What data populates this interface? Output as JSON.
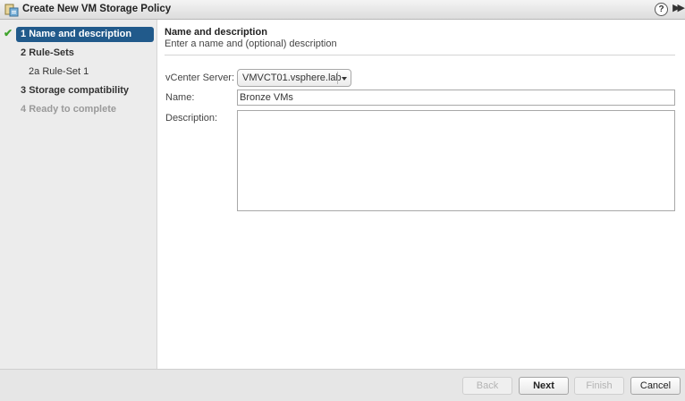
{
  "window": {
    "title": "Create New VM Storage Policy",
    "help_label": "?",
    "expand_label": "▶▶"
  },
  "steps": [
    {
      "number": "1",
      "label": "Name and description",
      "state": "active",
      "checked": true
    },
    {
      "number": "2",
      "label": "Rule-Sets",
      "state": "bold"
    },
    {
      "number": "2a",
      "label": "Rule-Set 1",
      "state": "sub"
    },
    {
      "number": "3",
      "label": "Storage compatibility",
      "state": "bold"
    },
    {
      "number": "4",
      "label": "Ready to complete",
      "state": "disabled"
    }
  ],
  "main": {
    "heading": "Name and description",
    "subheading": "Enter a name and (optional) description",
    "vcenter_label": "vCenter Server:",
    "vcenter_value": "VMVCT01.vsphere.lab",
    "name_label": "Name:",
    "name_value": "Bronze VMs",
    "description_label": "Description:",
    "description_value": ""
  },
  "footer": {
    "back": "Back",
    "next": "Next",
    "finish": "Finish",
    "cancel": "Cancel"
  },
  "colors": {
    "active_step": "#215a8b",
    "check": "#3fa32c"
  }
}
